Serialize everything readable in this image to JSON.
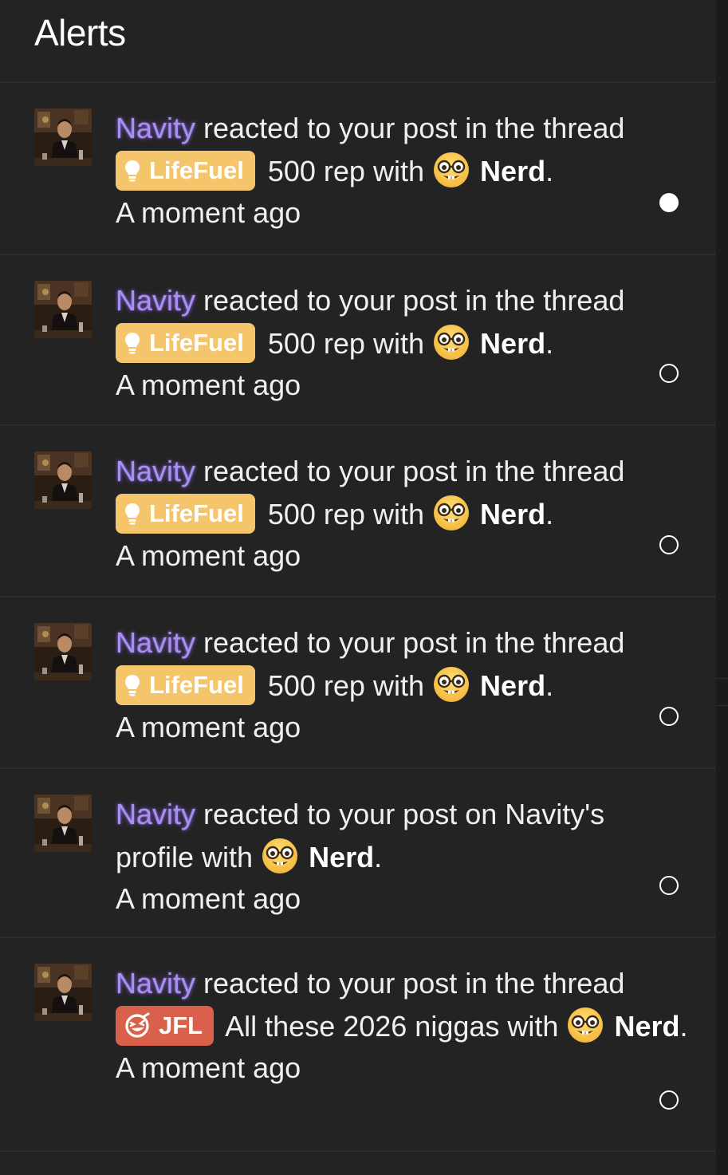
{
  "header": {
    "title": "Alerts"
  },
  "alerts": [
    {
      "user": "Navity",
      "text1": "reacted to your post in the thread",
      "prefix": {
        "label": "LifeFuel",
        "kind": "lifefuel"
      },
      "thread": "500 rep",
      "with": "with",
      "reaction": "Nerd",
      "period": ".",
      "time": "A moment ago",
      "read": false
    },
    {
      "user": "Navity",
      "text1": "reacted to your post in the thread",
      "prefix": {
        "label": "LifeFuel",
        "kind": "lifefuel"
      },
      "thread": "500 rep",
      "with": "with",
      "reaction": "Nerd",
      "period": ".",
      "time": "A moment ago",
      "read": true
    },
    {
      "user": "Navity",
      "text1": "reacted to your post in the thread",
      "prefix": {
        "label": "LifeFuel",
        "kind": "lifefuel"
      },
      "thread": "500 rep",
      "with": "with",
      "reaction": "Nerd",
      "period": ".",
      "time": "A moment ago",
      "read": true
    },
    {
      "user": "Navity",
      "text1": "reacted to your post in the thread",
      "prefix": {
        "label": "LifeFuel",
        "kind": "lifefuel"
      },
      "thread": "500 rep",
      "with": "with",
      "reaction": "Nerd",
      "period": ".",
      "time": "A moment ago",
      "read": true
    },
    {
      "user": "Navity",
      "text1": "reacted to your post on Navity's profile with",
      "reaction": "Nerd",
      "period": ".",
      "time": "A moment ago",
      "read": true
    },
    {
      "user": "Navity",
      "text1": "reacted to your post in the thread",
      "prefix": {
        "label": "JFL",
        "kind": "jfl"
      },
      "thread": "All these 2026 niggas",
      "with": "with",
      "reaction": "Nerd",
      "period": ".",
      "time": "A moment ago",
      "read": true
    }
  ],
  "colors": {
    "background": "#232323",
    "username": "#a98ff0",
    "lifefuel_pill": "#f5c56b",
    "jfl_pill": "#d9604a"
  },
  "icons": {
    "avatar": "user-avatar-photo",
    "reaction": "nerd-face-emoji",
    "lifefuel": "lightbulb-icon",
    "jfl": "laughing-face-icon",
    "unread": "filled-dot-icon",
    "read": "hollow-dot-icon"
  }
}
